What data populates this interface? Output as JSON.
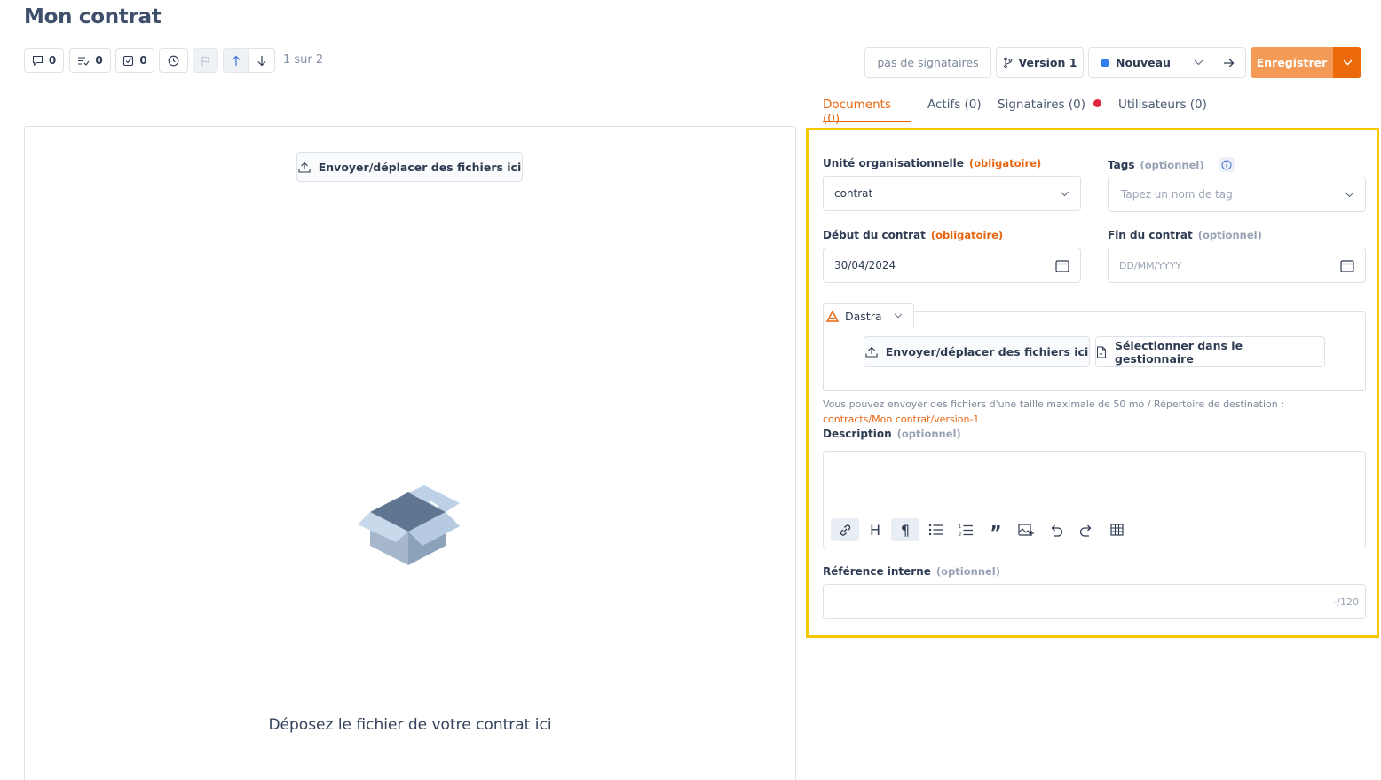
{
  "page": {
    "title": "Mon contrat"
  },
  "toolbar": {
    "comments_count": "0",
    "tasks_count": "0",
    "checks_count": "0",
    "pager": "1 sur 2"
  },
  "header": {
    "signers_label": "pas de signataires",
    "version_label": "Version 1",
    "status_label": "Nouveau",
    "save_label": "Enregistrer",
    "status_color": "#2f80ed",
    "accent_color": "#e8650f"
  },
  "tabs": [
    {
      "label": "Documents (0)"
    },
    {
      "label": "Actifs (0)"
    },
    {
      "label": "Signataires (0)"
    },
    {
      "label": "Utilisateurs (0)"
    }
  ],
  "left_panel": {
    "upload_label": "Envoyer/déplacer des fichiers ici",
    "drop_text": "Déposez le fichier de votre contrat ici"
  },
  "form": {
    "org_unit": {
      "label": "Unité organisationnelle",
      "badge": "(obligatoire)",
      "value": "contrat"
    },
    "tags": {
      "label": "Tags",
      "badge": "(optionnel)",
      "placeholder": "Tapez un nom de tag"
    },
    "start_date": {
      "label": "Début du contrat",
      "badge": "(obligatoire)",
      "value": "30/04/2024"
    },
    "end_date": {
      "label": "Fin du contrat",
      "badge": "(optionnel)",
      "placeholder": "DD/MM/YYYY"
    },
    "dastra": {
      "source_label": "Dastra",
      "upload_label": "Envoyer/déplacer des fichiers ici",
      "manager_label": "Sélectionner dans le gestionnaire",
      "hint": "Vous pouvez envoyer des fichiers d'une taille maximale de 50 mo / Répertoire de destination : ",
      "hint_path": "contracts/Mon contrat/version-1"
    },
    "description": {
      "label": "Description",
      "badge": "(optionnel)"
    },
    "reference": {
      "label": "Référence interne",
      "badge": "(optionnel)",
      "counter": "-/120"
    }
  }
}
